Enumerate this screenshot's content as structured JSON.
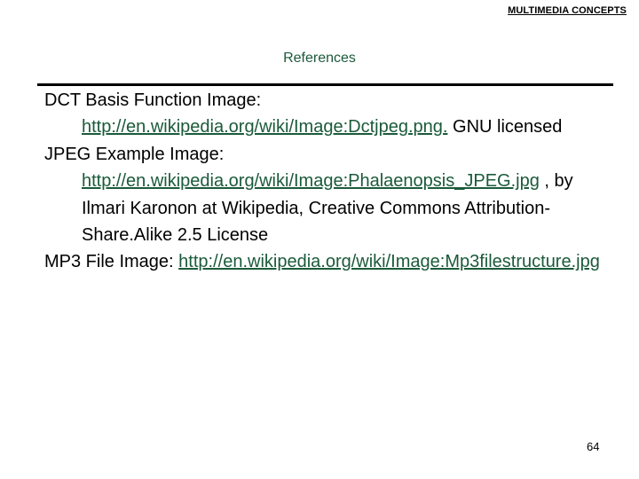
{
  "header": {
    "label": "MULTIMEDIA CONCEPTS"
  },
  "slide": {
    "title": "References",
    "page_number": "64"
  },
  "references": [
    {
      "label": "DCT Basis Function Image:",
      "url_text": "http://en.wikipedia.org/wiki/Image:Dctjpeg.png.",
      "suffix": " GNU licensed"
    },
    {
      "label": "JPEG Example Image:",
      "url_text": "http://en.wikipedia.org/wiki/Image:Phalaenopsis_JPEG.jpg",
      "suffix": " , by Ilmari Karonon at Wikipedia, Creative Commons Attribution-Share.Alike 2.5 License"
    },
    {
      "label": "MP3 File Image:",
      "url_text": "http://en.wikipedia.org/wiki/Image:Mp3filestructure.jpg",
      "suffix": ""
    }
  ],
  "colors": {
    "title": "#1b5a3a",
    "link": "#1b5a3a",
    "text": "#000000",
    "rule": "#000000"
  }
}
